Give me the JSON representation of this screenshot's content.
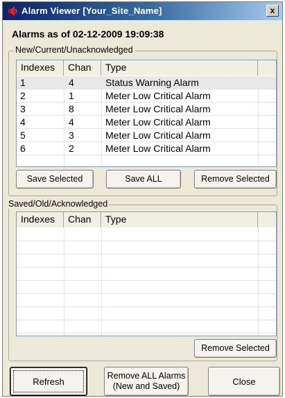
{
  "window": {
    "title": "Alarm Viewer [Your_Site_Name]",
    "close_label": "x",
    "title_icon": "alarm-bell-icon"
  },
  "alarms_asof": "Alarms as of 02-12-2009 19:09:38",
  "current": {
    "group_label": "New/Current/Unacknowledged",
    "columns": [
      "Indexes",
      "Chan",
      "Type"
    ],
    "rows": [
      {
        "index": "1",
        "chan": "4",
        "type": "Status Warning Alarm",
        "selected": true
      },
      {
        "index": "2",
        "chan": "1",
        "type": "Meter Low Critical Alarm"
      },
      {
        "index": "3",
        "chan": "8",
        "type": "Meter Low Critical Alarm"
      },
      {
        "index": "4",
        "chan": "4",
        "type": "Meter Low Critical Alarm"
      },
      {
        "index": "5",
        "chan": "3",
        "type": "Meter Low Critical Alarm"
      },
      {
        "index": "6",
        "chan": "2",
        "type": "Meter Low Critical Alarm"
      }
    ],
    "buttons": {
      "save_selected": "Save Selected",
      "save_all": "Save ALL",
      "remove_selected": "Remove Selected"
    }
  },
  "saved": {
    "group_label": "Saved/Old/Acknowledged",
    "columns": [
      "Indexes",
      "Chan",
      "Type"
    ],
    "rows": [],
    "buttons": {
      "remove_selected": "Remove Selected"
    }
  },
  "footer": {
    "refresh": "Refresh",
    "remove_all_line1": "Remove ALL Alarms",
    "remove_all_line2": "(New and Saved)",
    "close": "Close"
  }
}
